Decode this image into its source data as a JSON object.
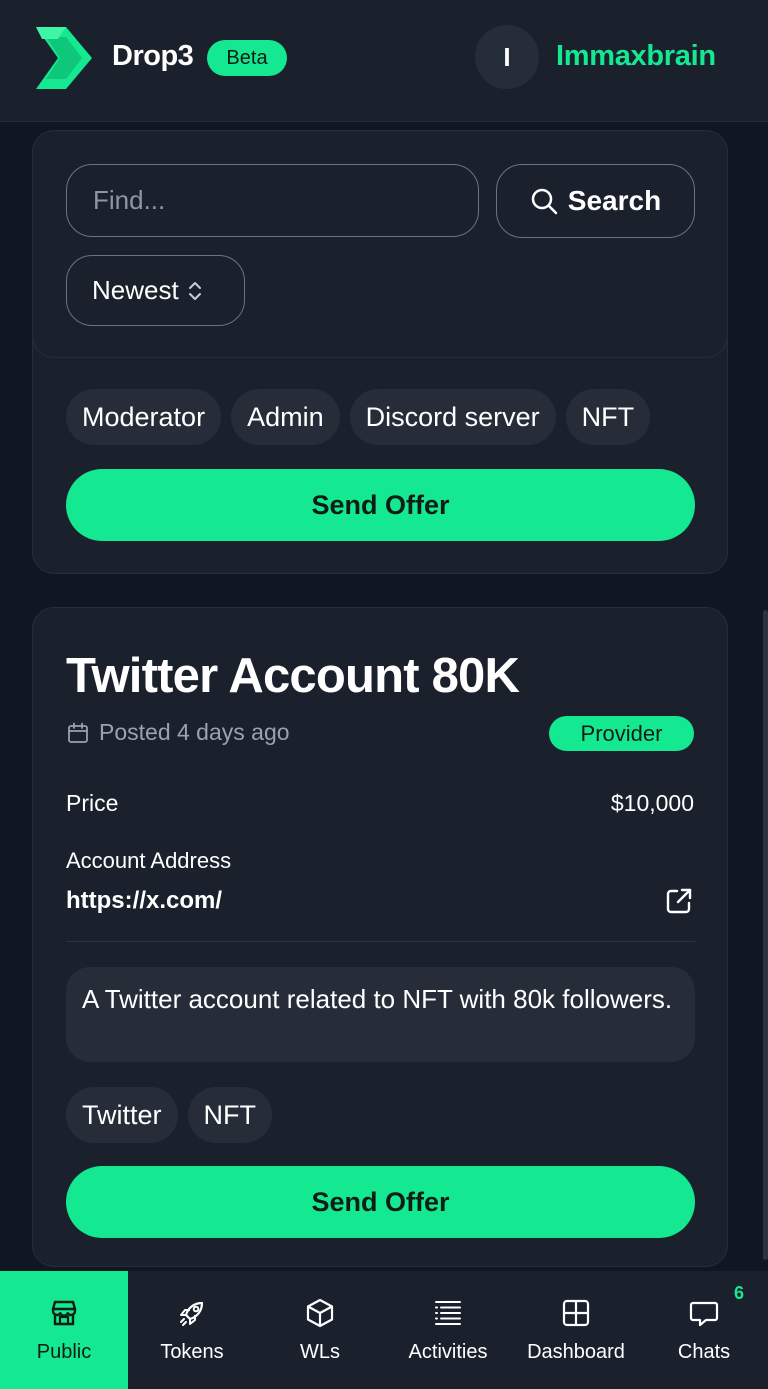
{
  "header": {
    "brand": "Drop3",
    "beta": "Beta",
    "avatar_initial": "I",
    "username": "Immaxbrain"
  },
  "filters": {
    "find_placeholder": "Find...",
    "find_value": "",
    "search_label": "Search",
    "sort_value": "Newest"
  },
  "previous_listing": {
    "tags": [
      "Moderator",
      "Admin",
      "Discord server",
      "NFT"
    ],
    "send_offer": "Send Offer"
  },
  "listing": {
    "title": "Twitter Account 80K",
    "posted": "Posted 4 days ago",
    "role_badge": "Provider",
    "price_label": "Price",
    "price_value": "$10,000",
    "address_label": "Account Address",
    "address_value": "https://x.com/",
    "description": "A Twitter account related to NFT with 80k followers.",
    "tags": [
      "Twitter",
      "NFT"
    ],
    "send_offer": "Send Offer"
  },
  "nav": {
    "items": [
      {
        "label": "Public",
        "icon": "store-icon",
        "active": true
      },
      {
        "label": "Tokens",
        "icon": "rocket-icon",
        "active": false
      },
      {
        "label": "WLs",
        "icon": "cube-icon",
        "active": false
      },
      {
        "label": "Activities",
        "icon": "list-icon",
        "active": false
      },
      {
        "label": "Dashboard",
        "icon": "grid-icon",
        "active": false
      },
      {
        "label": "Chats",
        "icon": "chat-icon",
        "active": false
      }
    ],
    "chats_badge": "6"
  },
  "colors": {
    "accent": "#14e890",
    "background": "#111722",
    "surface": "#1a212d"
  }
}
